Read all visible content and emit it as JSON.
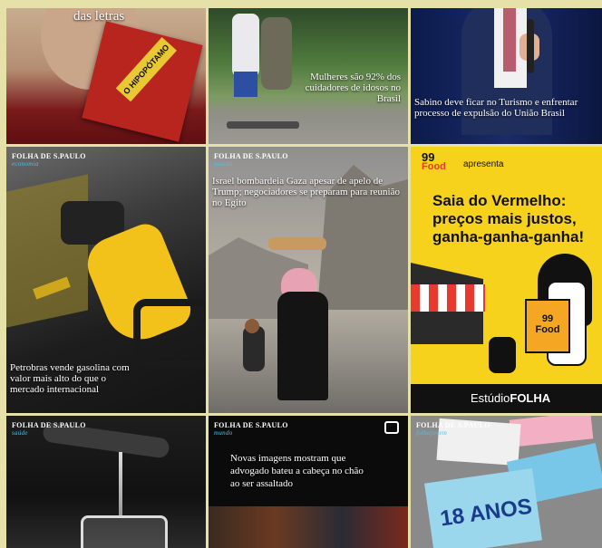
{
  "grid": {
    "posts": [
      {
        "caption": "das letras",
        "book_text": "O HIPOPÓTAMO"
      },
      {
        "caption": "Mulheres são 92% dos cuidadores de idosos no Brasil"
      },
      {
        "caption": "Sabino deve ficar no Turismo e enfrentar processo de expulsão do União Brasil"
      },
      {
        "brand": "FOLHA DE S.PAULO",
        "section": "economia",
        "caption": "Petrobras vende gasolina com valor mais alto do que o mercado internacional"
      },
      {
        "brand": "FOLHA DE S.PAULO",
        "section": "mundo",
        "caption": "Israel bombardeia Gaza apesar de apelo de Trump; negociadores se preparam para reunião no Egito"
      },
      {
        "logo_top": "99",
        "logo_bottom": "Food",
        "tag": "apresenta",
        "headline": "Saia do Vermelho: preços mais justos, ganha-ganha-ganha!",
        "box_top": "99",
        "box_bottom": "Food",
        "footer_a": "Estúdio",
        "footer_b": "FOLHA"
      },
      {
        "brand": "FOLHA DE S.PAULO",
        "section": "saúde"
      },
      {
        "brand": "FOLHA DE S.PAULO",
        "section": "mundo",
        "caption": "Novas imagens mostram que advogado bateu a cabeça no chão ao ser assaltado"
      },
      {
        "brand": "FOLHA DE S.PAULO",
        "section": "folhajovem",
        "sign_text": "18 ANOS"
      }
    ]
  }
}
